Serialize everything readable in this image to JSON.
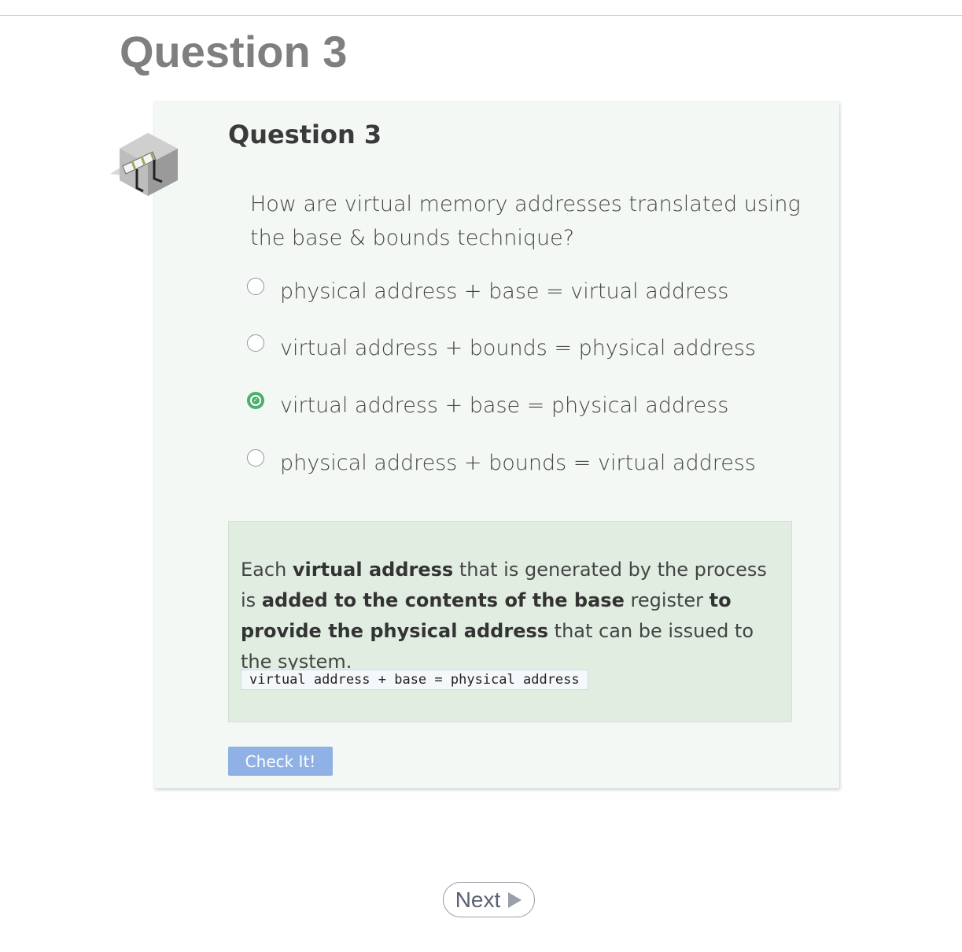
{
  "page": {
    "title": "Question 3"
  },
  "card": {
    "title": "Question 3",
    "icon": "hurdle-icon",
    "question": "How are virtual memory addresses translated using the base & bounds technique?",
    "options": [
      {
        "label": "physical address + base = virtual address",
        "selected": false
      },
      {
        "label": "virtual address + bounds = physical address",
        "selected": false
      },
      {
        "label": "virtual address + base = physical address",
        "selected": true
      },
      {
        "label": "physical address + bounds = virtual address",
        "selected": false
      }
    ],
    "feedback": {
      "p1": "Each ",
      "b1": "virtual address",
      "p2": " that is generated by the process is ",
      "b2": "added to the contents of the base",
      "p3": " register ",
      "b3": "to provide the physical address",
      "p4": " that can be issued to the system.",
      "code": "virtual address + base = physical address"
    },
    "check_label": "Check It!"
  },
  "navigation": {
    "next_label": "Next"
  },
  "colors": {
    "card_bg": "#f3f8f4",
    "feedback_bg": "#e2ede2",
    "selected_radio": "#4caf6d",
    "check_button": "#8fb1e6"
  }
}
